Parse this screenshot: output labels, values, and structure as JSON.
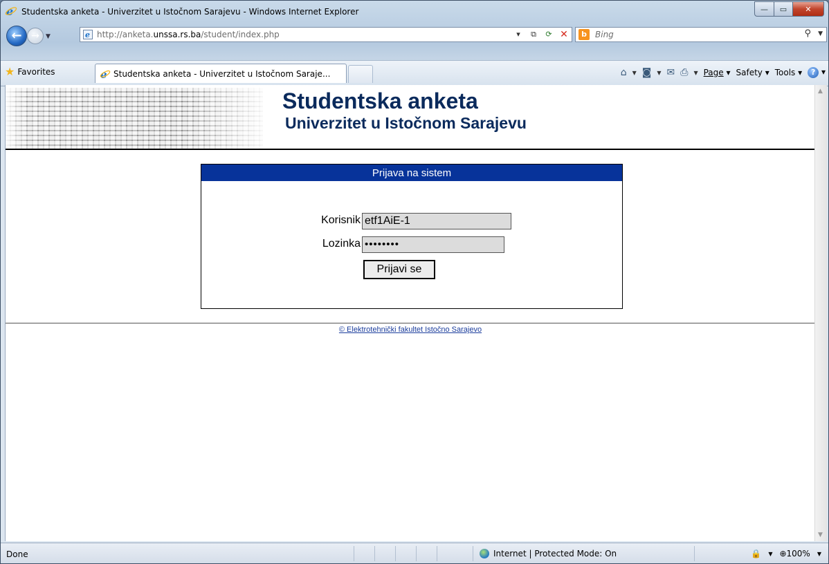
{
  "window": {
    "title": "Studentska anketa - Univerzitet u Istočnom Sarajevu - Windows Internet Explorer",
    "minimize_glyph": "—",
    "maximize_glyph": "▭",
    "close_glyph": "✕"
  },
  "address_bar": {
    "url_prefix": "http://anketa.",
    "url_domain": "unssa.rs.ba",
    "url_suffix": "/student/index.php"
  },
  "search": {
    "placeholder": "Bing",
    "logo_letter": "b"
  },
  "favorites": {
    "label": "Favorites"
  },
  "tab": {
    "label": "Studentska anketa - Univerzitet u Istočnom Saraje..."
  },
  "command_bar": {
    "page": "Page",
    "safety": "Safety",
    "tools": "Tools",
    "help": "?"
  },
  "page": {
    "site_title": "Studentska anketa",
    "site_subtitle": "Univerzitet u Istočnom Sarajevu",
    "login": {
      "header": "Prijava na sistem",
      "username_label": "Korisnik",
      "username_value": "etf1AiE-1",
      "password_label": "Lozinka",
      "password_value": "••••••••",
      "submit_label": "Prijavi se"
    },
    "footer": "© Elektrotehnički fakultet Istočno Sarajevo"
  },
  "status_bar": {
    "status": "Done",
    "zone": "Internet | Protected Mode: On",
    "zoom": "100%"
  }
}
